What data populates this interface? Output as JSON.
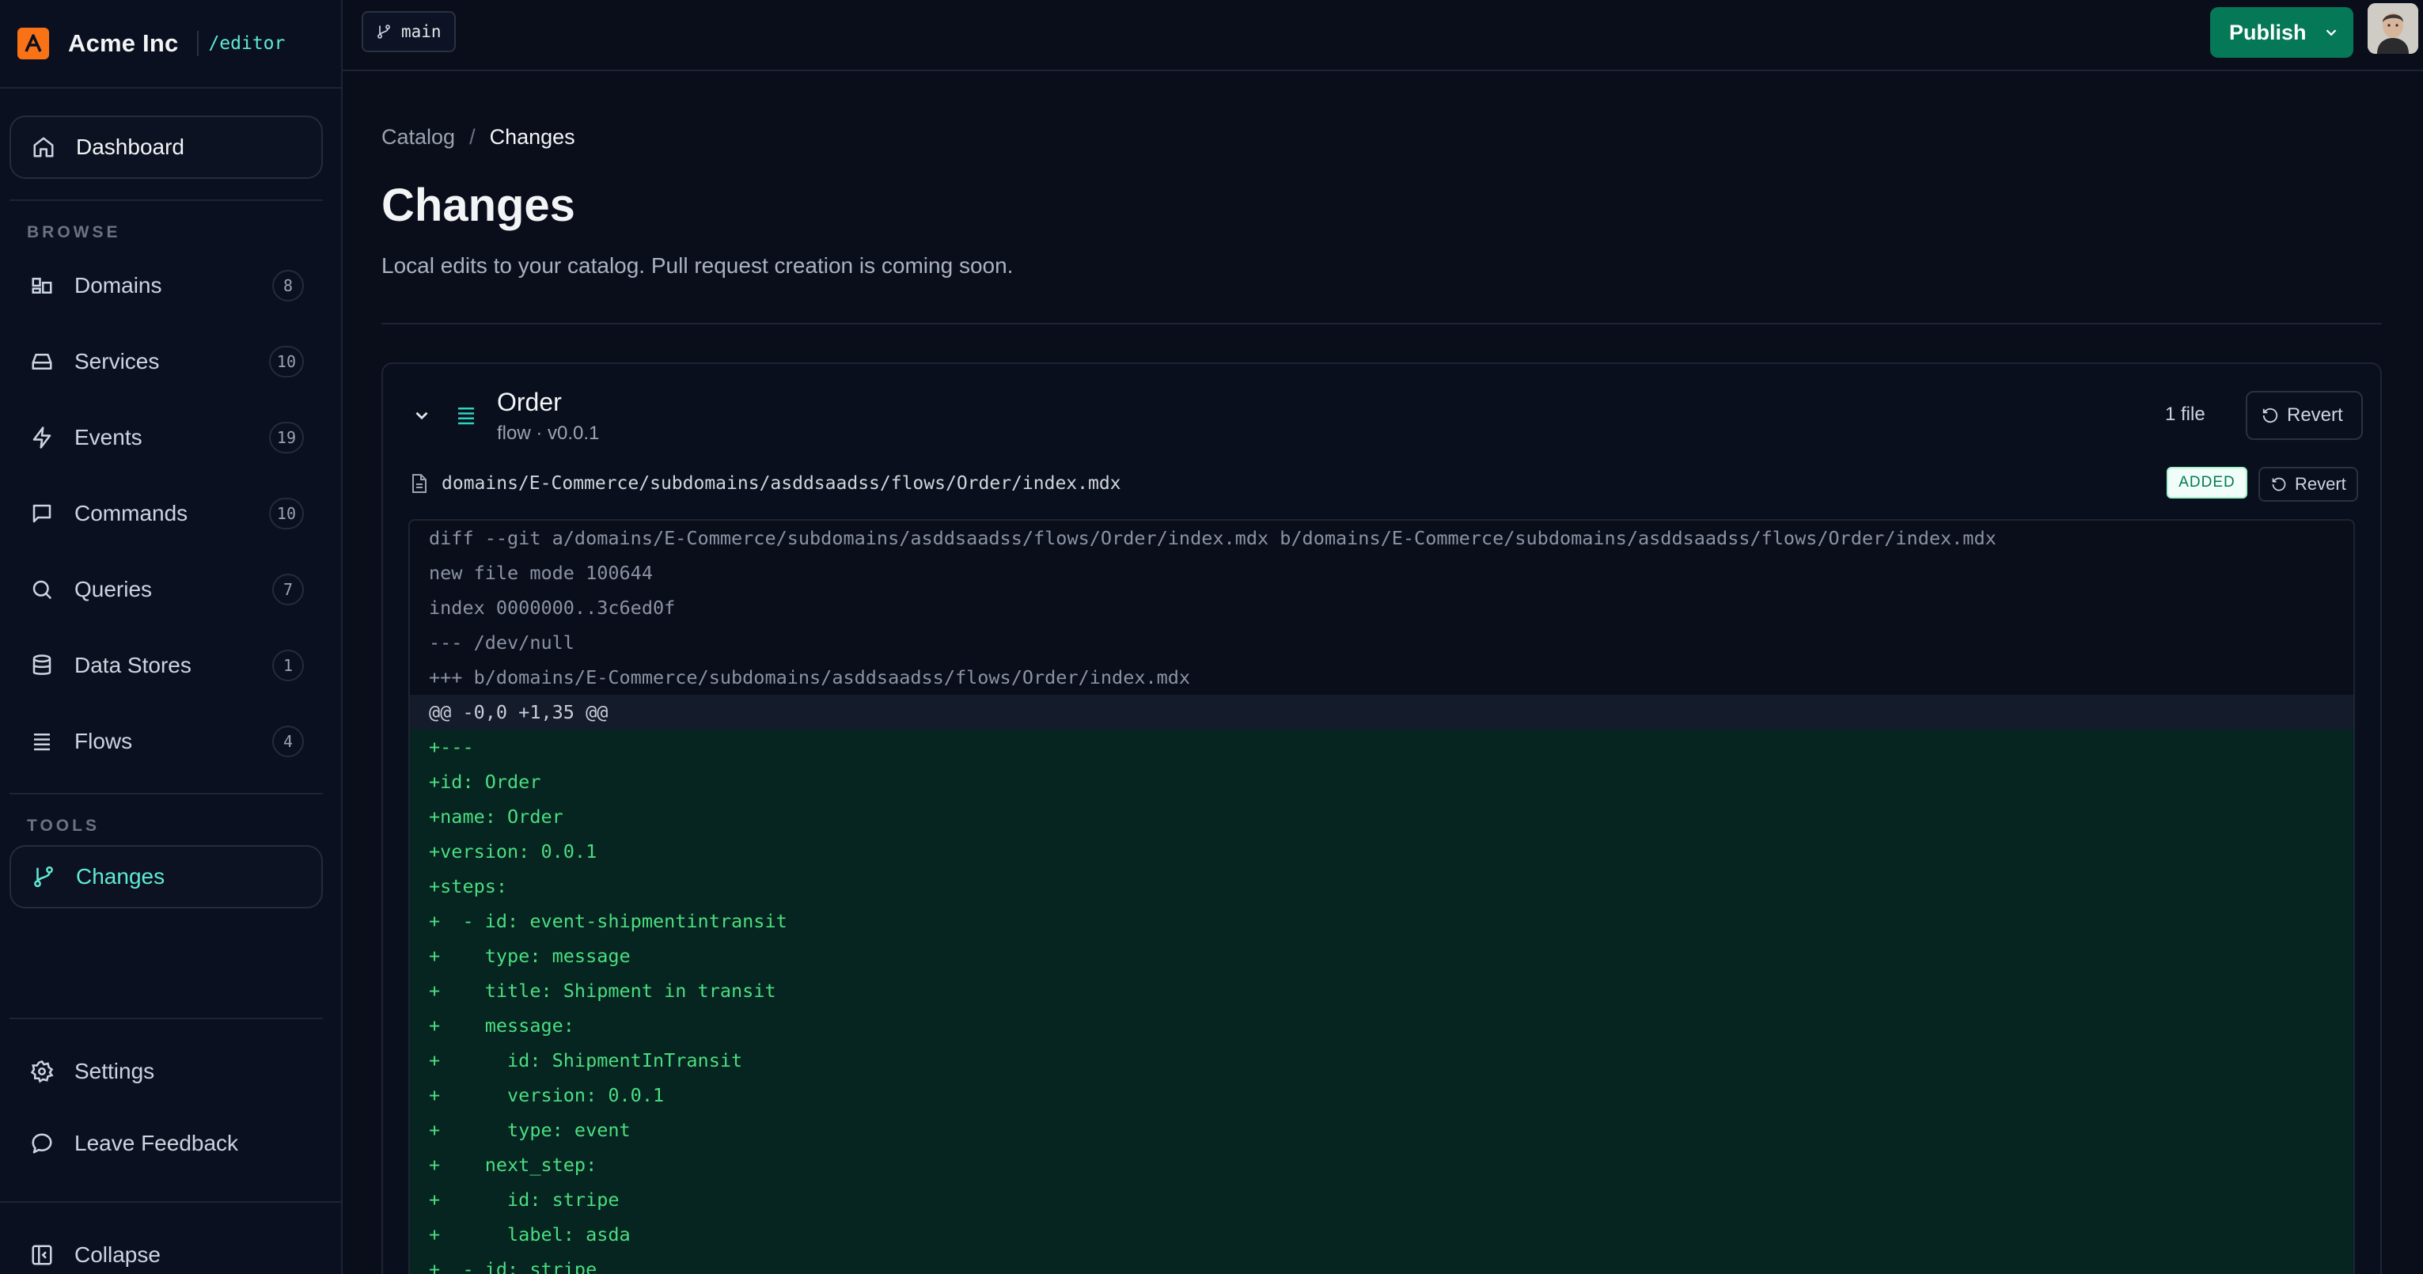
{
  "app": {
    "name": "Acme Inc",
    "path": "/editor"
  },
  "sidebar": {
    "dashboard": {
      "label": "Dashboard"
    },
    "browse_label": "BROWSE",
    "browse_items": [
      {
        "label": "Domains",
        "count": "8",
        "icon": "domains-icon"
      },
      {
        "label": "Services",
        "count": "10",
        "icon": "inbox-icon"
      },
      {
        "label": "Events",
        "count": "19",
        "icon": "lightning-icon"
      },
      {
        "label": "Commands",
        "count": "10",
        "icon": "message-square-icon"
      },
      {
        "label": "Queries",
        "count": "7",
        "icon": "search-icon"
      },
      {
        "label": "Data Stores",
        "count": "1",
        "icon": "database-icon"
      },
      {
        "label": "Flows",
        "count": "4",
        "icon": "flows-icon"
      }
    ],
    "tools_label": "TOOLS",
    "tools_items": [
      {
        "label": "Changes",
        "icon": "git-branch-icon",
        "active": true
      }
    ],
    "footer_items": [
      {
        "label": "Settings",
        "icon": "gear-icon"
      },
      {
        "label": "Leave Feedback",
        "icon": "message-circle-icon"
      }
    ],
    "collapse_label": "Collapse"
  },
  "topbar": {
    "branch": "main",
    "publish_label": "Publish"
  },
  "page": {
    "breadcrumb": [
      "Catalog",
      "Changes"
    ],
    "breadcrumb_sep": "/",
    "title": "Changes",
    "subtitle": "Local edits to your catalog. Pull request creation is coming soon."
  },
  "change": {
    "name": "Order",
    "meta": "flow · v0.0.1",
    "file_count": "1 file",
    "revert_label": "Revert",
    "file": {
      "path": "domains/E-Commerce/subdomains/asddsaadss/flows/Order/index.mdx",
      "status": "ADDED",
      "revert_label": "Revert"
    },
    "diff_lines": [
      {
        "type": "meta",
        "text": "diff --git a/domains/E-Commerce/subdomains/asddsaadss/flows/Order/index.mdx b/domains/E-Commerce/subdomains/asddsaadss/flows/Order/index.mdx"
      },
      {
        "type": "meta",
        "text": "new file mode 100644"
      },
      {
        "type": "meta",
        "text": "index 0000000..3c6ed0f"
      },
      {
        "type": "meta",
        "text": "--- /dev/null"
      },
      {
        "type": "meta",
        "text": "+++ b/domains/E-Commerce/subdomains/asddsaadss/flows/Order/index.mdx"
      },
      {
        "type": "hunk",
        "text": "@@ -0,0 +1,35 @@"
      },
      {
        "type": "add",
        "text": "+---"
      },
      {
        "type": "add",
        "text": "+id: Order"
      },
      {
        "type": "add",
        "text": "+name: Order"
      },
      {
        "type": "add",
        "text": "+version: 0.0.1"
      },
      {
        "type": "add",
        "text": "+steps:"
      },
      {
        "type": "add",
        "text": "+  - id: event-shipmentintransit"
      },
      {
        "type": "add",
        "text": "+    type: message"
      },
      {
        "type": "add",
        "text": "+    title: Shipment in transit"
      },
      {
        "type": "add",
        "text": "+    message:"
      },
      {
        "type": "add",
        "text": "+      id: ShipmentInTransit"
      },
      {
        "type": "add",
        "text": "+      version: 0.0.1"
      },
      {
        "type": "add",
        "text": "+      type: event"
      },
      {
        "type": "add",
        "text": "+    next_step:"
      },
      {
        "type": "add",
        "text": "+      id: stripe"
      },
      {
        "type": "add",
        "text": "+      label: asda"
      },
      {
        "type": "add",
        "text": "+  - id: stripe"
      }
    ]
  },
  "colors": {
    "accent": "#5eead4",
    "publish": "#047857",
    "added_text": "#4ade80",
    "added_bg": "#062420",
    "brand_logo": "#f97316"
  }
}
